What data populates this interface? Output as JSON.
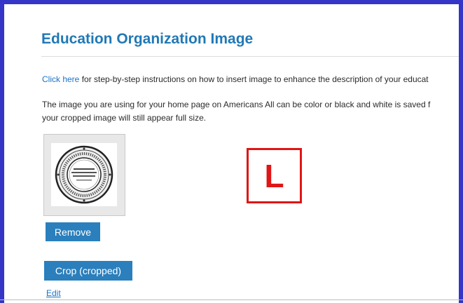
{
  "page": {
    "title": "Education Organization Image",
    "instructions": {
      "link_text": "Click here",
      "text": " for step-by-step instructions on how to insert image to enhance the description of your educat"
    },
    "description_line1": "The image you are using for your home page on Americans All can be color or black and white is saved f",
    "description_line2": "your cropped image will still appear full size."
  },
  "image_preview": {
    "icon": "circular-seal-icon"
  },
  "buttons": {
    "remove_label": "Remove",
    "crop_label": "Crop (cropped)",
    "edit_label": "Edit"
  },
  "marker": {
    "label": "L"
  },
  "colors": {
    "frame_border": "#3535c8",
    "title_blue": "#2079b6",
    "button_blue": "#2a7fbc",
    "link_blue": "#1a73c8",
    "marker_red": "#e01515"
  }
}
